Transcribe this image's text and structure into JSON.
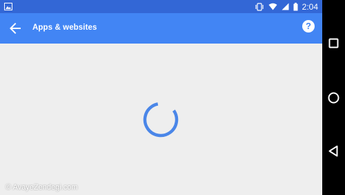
{
  "status_bar": {
    "time": "2:04",
    "icons": [
      "image-icon",
      "vibrate-icon",
      "wifi-icon",
      "signal-icon",
      "battery-icon"
    ]
  },
  "app_bar": {
    "title": "Apps & websites",
    "back_icon": "arrow-back-icon",
    "help_icon": "help-icon",
    "help_glyph": "?",
    "color": "#4285f4",
    "status_color": "#3367d6"
  },
  "content": {
    "loading": true,
    "spinner_color": "#4a86e8",
    "background": "#eeeeee"
  },
  "watermark": {
    "text": "© AvayeZendegi.com"
  },
  "nav_bar": {
    "buttons": [
      "recents-button",
      "home-button",
      "back-button"
    ]
  }
}
